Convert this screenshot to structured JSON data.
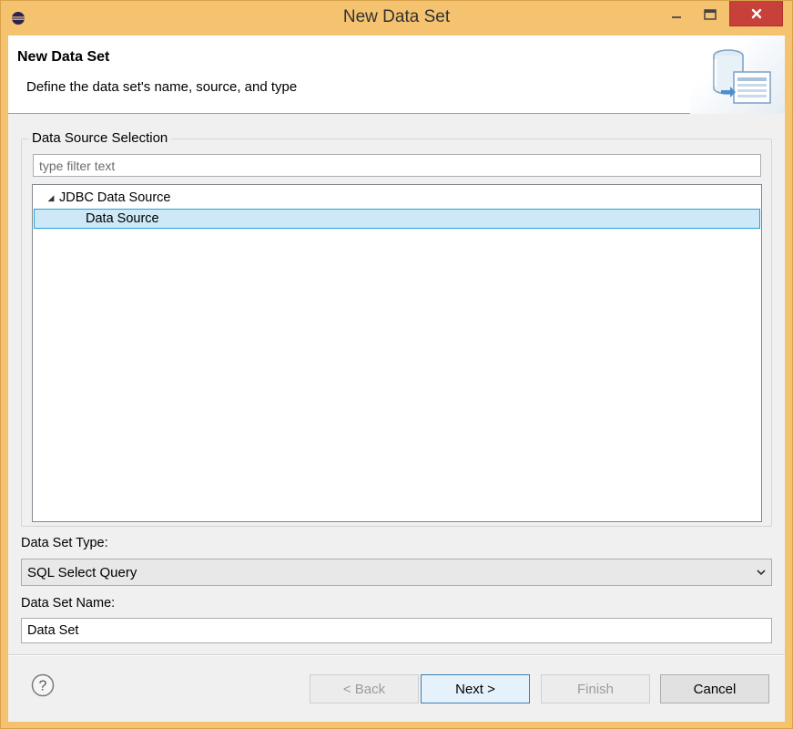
{
  "window": {
    "title": "New Data Set",
    "app_icon": "eclipse-icon",
    "controls": {
      "minimize": "minimize-icon",
      "maximize": "maximize-icon",
      "close": "close-icon"
    }
  },
  "banner": {
    "title": "New Data Set",
    "subtitle": "Define the data set's name, source, and type",
    "icon": "database-dataset-icon"
  },
  "data_source_selection": {
    "label": "Data Source Selection",
    "filter_placeholder": "type filter text",
    "filter_value": "",
    "tree": [
      {
        "label": "JDBC Data Source",
        "expanded": true,
        "selected": false,
        "level": 0
      },
      {
        "label": "Data Source",
        "expanded": false,
        "selected": true,
        "level": 1
      }
    ]
  },
  "data_set_type": {
    "label": "Data Set Type:",
    "selected": "SQL Select Query"
  },
  "data_set_name": {
    "label": "Data Set Name:",
    "value": "Data Set"
  },
  "buttons": {
    "back": "< Back",
    "next": "Next >",
    "finish": "Finish",
    "cancel": "Cancel"
  },
  "colors": {
    "title_bar": "#f5c36f",
    "close_button": "#c7403a",
    "selection": "#cde8f6",
    "selection_border": "#26a0da"
  }
}
